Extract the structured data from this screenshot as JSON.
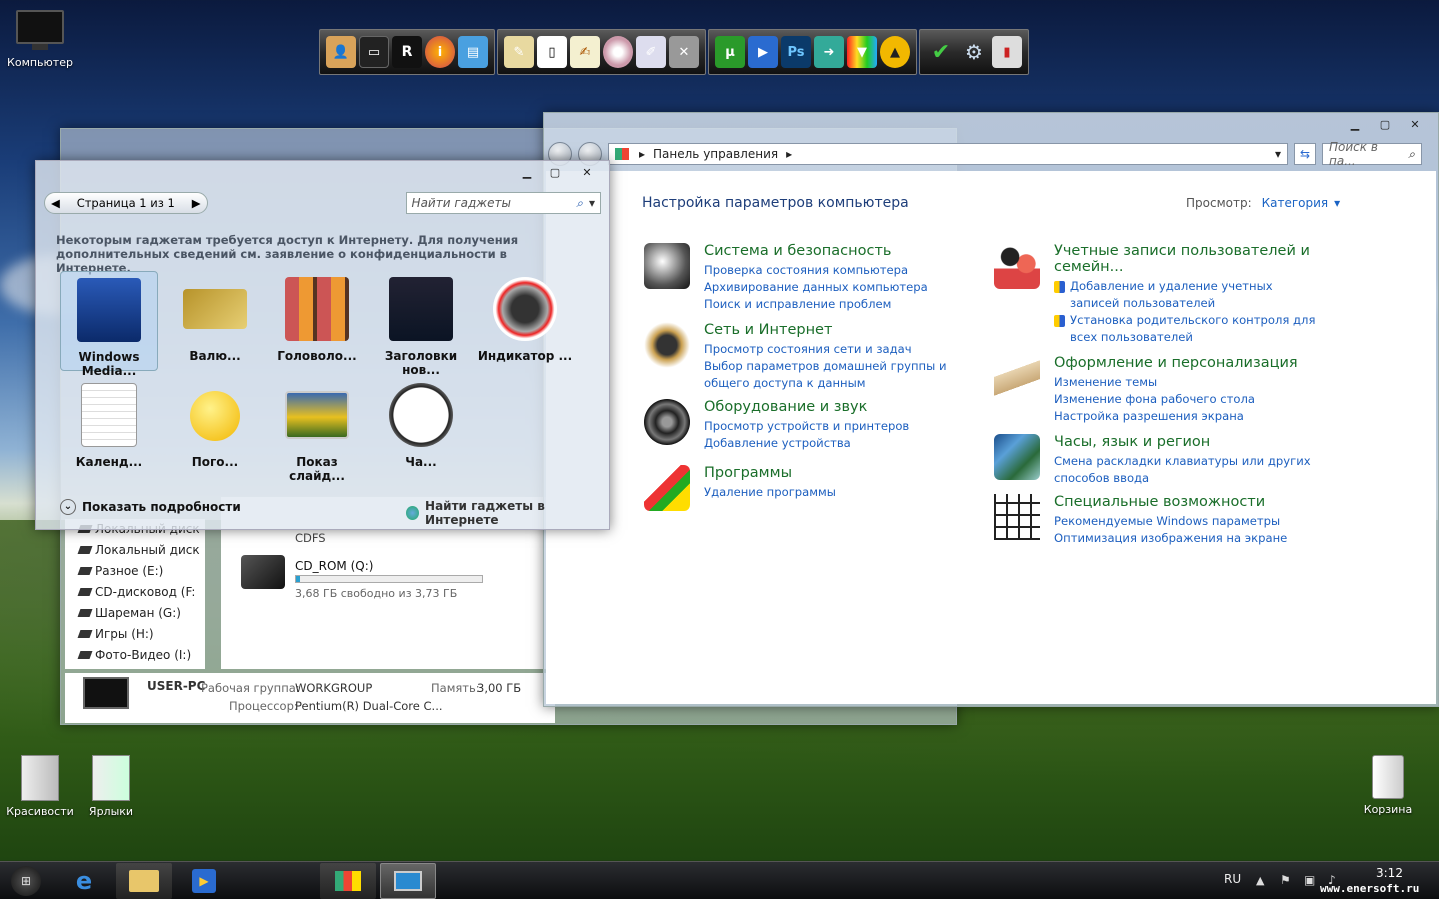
{
  "desktop": {
    "icons": [
      {
        "label": "Компьютер"
      },
      {
        "label": "Красивости"
      },
      {
        "label": "Ярлыки"
      },
      {
        "label": "Корзина"
      }
    ]
  },
  "control_panel": {
    "address": "Панель управления",
    "search_placeholder": "Поиск в па...",
    "heading": "Настройка параметров компьютера",
    "view_label": "Просмотр:",
    "view_value": "Категория",
    "left": [
      {
        "title": "Система и безопасность",
        "links": [
          "Проверка состояния компьютера",
          "Архивирование данных компьютера",
          "Поиск и исправление проблем"
        ]
      },
      {
        "title": "Сеть и Интернет",
        "links": [
          "Просмотр состояния сети и задач",
          "Выбор параметров домашней группы и общего доступа к данным"
        ]
      },
      {
        "title": "Оборудование и звук",
        "links": [
          "Просмотр устройств и принтеров",
          "Добавление устройства"
        ]
      },
      {
        "title": "Программы",
        "links": [
          "Удаление программы"
        ]
      }
    ],
    "right": [
      {
        "title": "Учетные записи пользователей и семейн...",
        "links": [
          "Добавление и удаление учетных записей пользователей",
          "Установка родительского контроля для всех пользователей"
        ]
      },
      {
        "title": "Оформление и персонализация",
        "links": [
          "Изменение темы",
          "Изменение фона рабочего стола",
          "Настройка разрешения экрана"
        ]
      },
      {
        "title": "Часы, язык и регион",
        "links": [
          "Смена раскладки клавиатуры или других способов ввода"
        ]
      },
      {
        "title": "Специальные возможности",
        "links": [
          "Рекомендуемые Windows параметры",
          "Оптимизация изображения на экране"
        ]
      }
    ]
  },
  "gadgets": {
    "page_label": "Страница 1 из 1",
    "search_placeholder": "Найти гаджеты",
    "note": "Некоторым гаджетам требуется доступ к Интернету. Для получения дополнительных сведений см. заявление о конфиденциальности в Интернете.",
    "items": [
      "Windows Media...",
      "Валю...",
      "Головоло...",
      "Заголовки нов...",
      "Индикатор ...",
      "Календ...",
      "Пого...",
      "Показ слайд...",
      "Ча..."
    ],
    "show_details": "Показать подробности",
    "find_online": "Найти гаджеты в Интернете"
  },
  "explorer": {
    "drives": [
      "Локальный диск",
      "Локальный диск",
      "Разное (E:)",
      "CD-дисковод (F:",
      "Шареман (G:)",
      "Игры (H:)",
      "Фото-Видео (I:)"
    ],
    "cdfs": "CDFS",
    "cd_name": "CD_ROM (Q:)",
    "cd_free": "3,68 ГБ свободно из 3,73 ГБ",
    "pc_name": "USER-PC",
    "workgroup_label": "Рабочая группа:",
    "workgroup": "WORKGROUP",
    "memory_label": "Память:",
    "memory": "3,00 ГБ",
    "cpu_label": "Процессор:",
    "cpu": "Pentium(R) Dual-Core  C..."
  },
  "taskbar": {
    "lang": "RU",
    "time": "3:12",
    "watermark": "www.enersoft.ru"
  }
}
